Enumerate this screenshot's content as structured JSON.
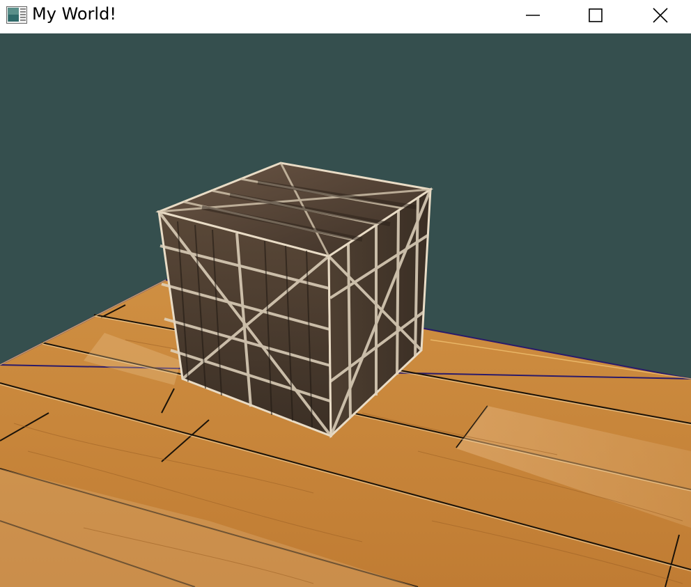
{
  "window": {
    "title": "My World!",
    "controls": [
      "minimize-icon",
      "maximize-icon",
      "close-icon"
    ]
  },
  "scene": {
    "background_color": "#354f4e",
    "floor_color": "#c98a3c",
    "crate_color": "#4a3a2c"
  }
}
